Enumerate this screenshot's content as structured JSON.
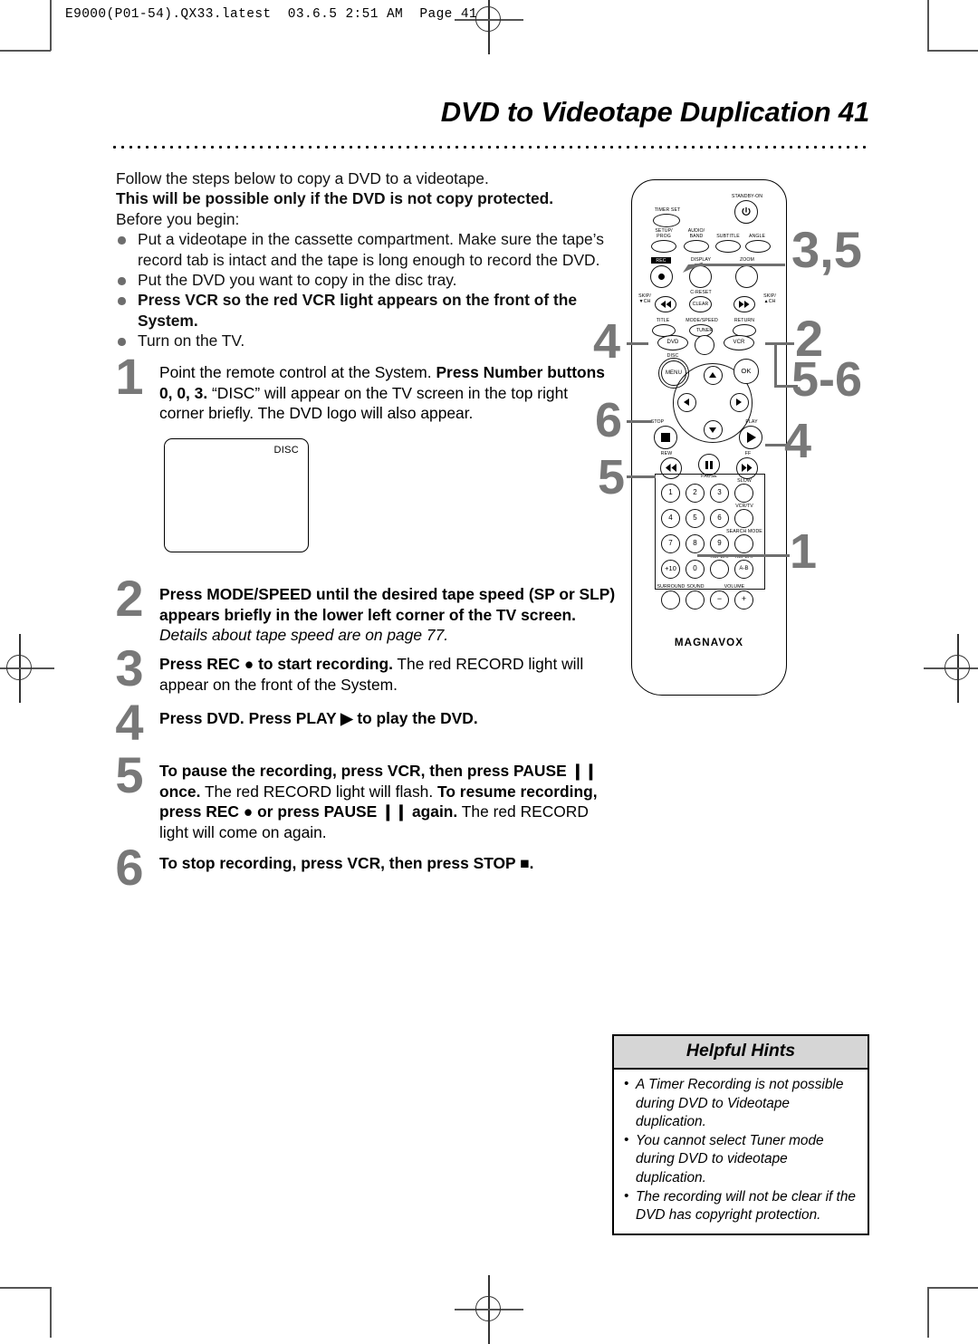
{
  "print_header": "E9000(P01-54).QX33.latest  03.6.5 2:51 AM  Page 41",
  "title": "DVD to Videotape Duplication  41",
  "intro": {
    "line1": "Follow the steps below to copy a DVD to a videotape.",
    "line2_bold": "This will be possible only if the DVD is not copy protected.",
    "line3": "Before you begin:",
    "bullets": [
      {
        "text": "Put a videotape in the cassette compartment. Make sure the tape’s record tab is intact and the tape is long enough to record the DVD.",
        "bold": false
      },
      {
        "text": "Put the DVD you want to copy in the disc tray.",
        "bold": false
      },
      {
        "text": "Press VCR so the red VCR light appears on the front of the System.",
        "bold": true
      },
      {
        "text": "Turn on the TV.",
        "bold": false
      }
    ]
  },
  "steps": [
    {
      "num": "1",
      "html": "Point the remote control at the System. <b>Press Number buttons 0, 0, 3.</b> “DISC” will appear on the TV screen in the top right corner briefly. The DVD logo will also appear."
    },
    {
      "num": "2",
      "html": "<b>Press MODE/SPEED until the desired tape speed (SP or SLP) appears briefly in the lower left corner of the TV screen.</b> <i>Details about tape speed are on page 77.</i>"
    },
    {
      "num": "3",
      "html": "<b>Press REC ● to start recording.</b> The red RECORD light will appear on the front of the System."
    },
    {
      "num": "4",
      "html": "<b>Press DVD. Press PLAY ▶ to play the DVD.</b>"
    },
    {
      "num": "5",
      "html": "<b>To pause the recording, press VCR, then press PAUSE ❙❙ once.</b> The red RECORD light will flash. <b>To resume recording, press REC ● or press PAUSE ❙❙ again.</b> The red RECORD light will come on again."
    },
    {
      "num": "6",
      "html": "<b>To stop recording, press VCR, then press STOP ■.</b>"
    }
  ],
  "disc_screen": {
    "label": "DISC"
  },
  "hints": {
    "heading": "Helpful Hints",
    "items": [
      "A Timer Recording is not possible during DVD to Videotape duplication.",
      "You cannot select Tuner mode during DVD to videotape duplication.",
      "The recording will not be clear if the DVD has copyright protection."
    ]
  },
  "remote": {
    "brand": "MAGNAVOX",
    "labels": {
      "timer_set": "TIMER SET",
      "standby_on": "STANDBY-ON",
      "setup_prog": "SETUP/\nPROG",
      "audio_band": "AUDIO/\nBAND",
      "subtitle": "SUBTITLE",
      "angle": "ANGLE",
      "rec": "REC",
      "display": "DISPLAY",
      "zoom": "ZOOM",
      "skip_down": "SKIP/\n▼CH",
      "c_reset": "C-RESET",
      "clear": "CLEAR",
      "skip_up": "SKIP/\n▲CH",
      "title": "TITLE",
      "mode_speed": "MODE/SPEED",
      "return": "RETURN",
      "tuner": "TUNER",
      "dvd": "DVD",
      "vcr": "VCR",
      "disc": "DISC",
      "menu": "MENU",
      "ok": "OK",
      "stop": "STOP",
      "play": "PLAY",
      "rew": "REW",
      "pause": "PAUSE",
      "ff": "FF",
      "slow": "SLOW",
      "vcr_tv": "VCR/TV",
      "search_mode": "SEARCH MODE",
      "repeat": "REPEAT",
      "repeat_ab": "REPEAT",
      "ab": "A-B",
      "surround": "SURROUND",
      "sound": "SOUND",
      "volume": "VOLUME",
      "vol_minus": "−",
      "vol_plus": "+",
      "plus_ten": "+10"
    },
    "keypad": [
      "1",
      "2",
      "3",
      "4",
      "5",
      "6",
      "7",
      "8",
      "9",
      "+10",
      "0"
    ]
  },
  "callouts": [
    {
      "id": "c-35",
      "text": "3,5"
    },
    {
      "id": "c-4l",
      "text": "4"
    },
    {
      "id": "c-2",
      "text": "2"
    },
    {
      "id": "c-56",
      "text": "5-6"
    },
    {
      "id": "c-6",
      "text": "6"
    },
    {
      "id": "c-4r",
      "text": "4"
    },
    {
      "id": "c-5",
      "text": "5"
    },
    {
      "id": "c-1",
      "text": "1"
    }
  ],
  "colors": {
    "callout": "#787878",
    "hint_header": "#d6d6d6",
    "bullet": "#6d6d6d"
  }
}
